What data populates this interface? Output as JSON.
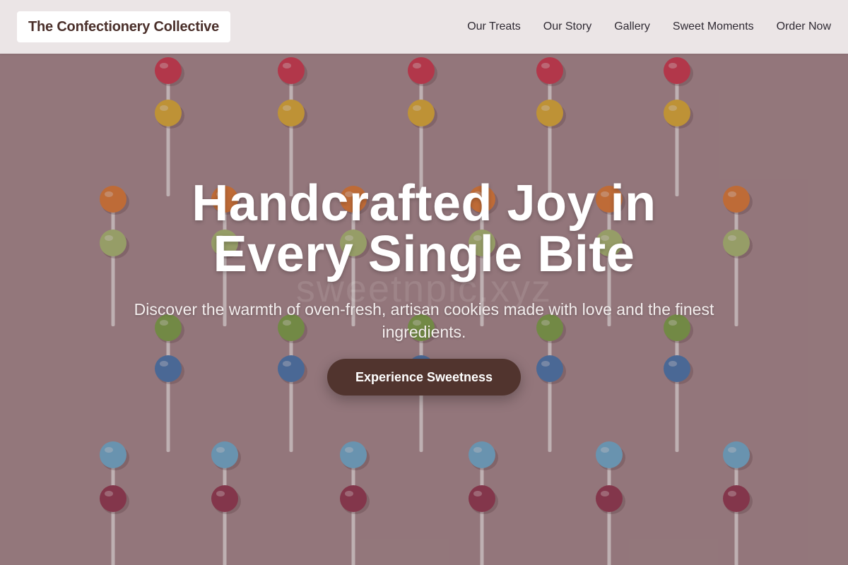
{
  "header": {
    "logo_text": "The Confectionery Collective",
    "nav": [
      {
        "label": "Our Treats"
      },
      {
        "label": "Our Story"
      },
      {
        "label": "Gallery"
      },
      {
        "label": "Sweet Moments"
      },
      {
        "label": "Order Now"
      }
    ]
  },
  "hero": {
    "title": "Handcrafted Joy in Every Single Bite",
    "subtitle": "Discover the warmth of oven-fresh, artisan cookies made with love and the finest ingredients.",
    "cta_label": "Experience Sweetness",
    "watermark": "sweetnpic.xyz"
  },
  "colors": {
    "header_bg": "#eee9ea",
    "logo_text": "#4a2f2a",
    "nav_text": "#2f2a33",
    "cta_bg": "#51342e",
    "hero_overlay": "#9b7f82",
    "lollipops": [
      "#d61f3a",
      "#e8b21a",
      "#e8731c",
      "#a9c46a",
      "#6ea432",
      "#2e6fb3",
      "#5fb4de",
      "#8a1e3c"
    ]
  }
}
